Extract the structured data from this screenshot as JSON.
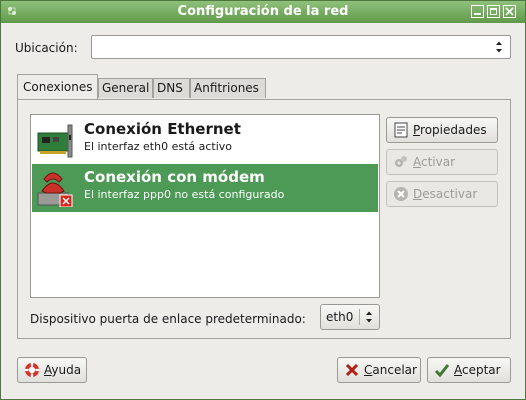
{
  "window": {
    "title": "Configuración de la red"
  },
  "location": {
    "label": "Ubicación:",
    "value": ""
  },
  "tabs": [
    {
      "label": "Conexiones",
      "active": true
    },
    {
      "label": "General",
      "active": false
    },
    {
      "label": "DNS",
      "active": false
    },
    {
      "label": "Anfitriones",
      "active": false
    }
  ],
  "connections": [
    {
      "name": "Conexión Ethernet",
      "description": "El interfaz eth0 está activo",
      "icon": "network-card-icon",
      "selected": false
    },
    {
      "name": "Conexión con módem",
      "description": "El interfaz ppp0 no está configurado",
      "icon": "modem-phone-icon",
      "selected": true
    }
  ],
  "side_buttons": {
    "properties": "Propiedades",
    "activate": "Activar",
    "deactivate": "Desactivar"
  },
  "gateway": {
    "label": "Dispositivo puerta de enlace predeterminado:",
    "value": "eth0"
  },
  "footer": {
    "help": "Ayuda",
    "cancel": "Cancelar",
    "ok": "Aceptar"
  },
  "colors": {
    "titlebar": "#6aa653",
    "selection": "#4c9a55"
  }
}
